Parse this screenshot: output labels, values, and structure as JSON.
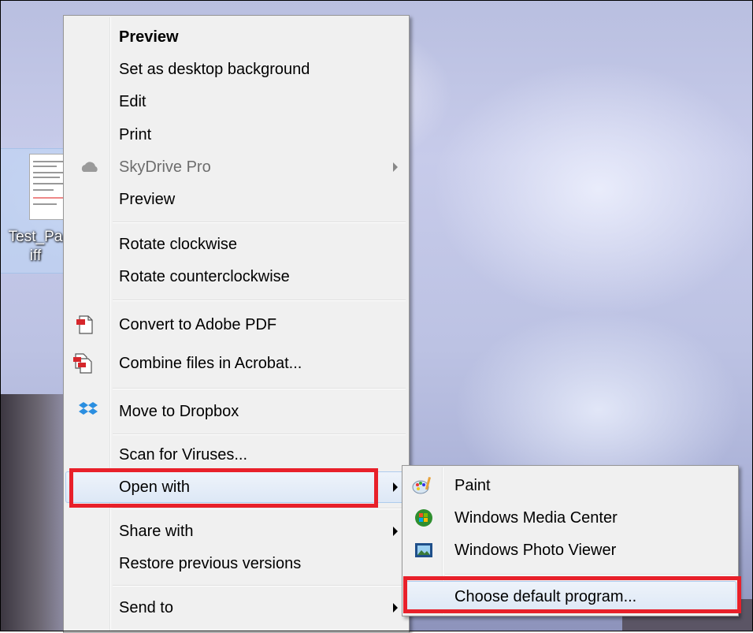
{
  "desktop": {
    "icon_label_line1": "Test_Pa",
    "icon_label_line2": "iff"
  },
  "context_menu": {
    "items": [
      {
        "label": "Preview",
        "bold": true
      },
      {
        "label": "Set as desktop background"
      },
      {
        "label": "Edit"
      },
      {
        "label": "Print"
      },
      {
        "label": "SkyDrive Pro",
        "disabled": true,
        "submenu": true,
        "icon": "skydrive-cloud-icon"
      },
      {
        "label": "Preview"
      },
      {
        "label": "Rotate clockwise"
      },
      {
        "label": "Rotate counterclockwise"
      },
      {
        "label": "Convert to Adobe PDF",
        "icon": "adobe-pdf-icon"
      },
      {
        "label": "Combine files in Acrobat...",
        "icon": "acrobat-combine-icon"
      },
      {
        "label": "Move to Dropbox",
        "icon": "dropbox-icon"
      },
      {
        "label": "Scan for Viruses..."
      },
      {
        "label": "Open with",
        "submenu": true,
        "highlighted": true
      },
      {
        "label": "Share with",
        "submenu": true
      },
      {
        "label": "Restore previous versions"
      },
      {
        "label": "Send to",
        "submenu": true
      }
    ]
  },
  "open_with_submenu": {
    "items": [
      {
        "label": "Paint",
        "icon": "paint-icon"
      },
      {
        "label": "Windows Media Center",
        "icon": "windows-media-center-icon"
      },
      {
        "label": "Windows Photo Viewer",
        "icon": "photo-viewer-icon"
      },
      {
        "label": "Choose default program...",
        "highlighted": true
      }
    ]
  },
  "colors": {
    "annotation_red": "#e8202a",
    "highlight_border": "#aecbed",
    "menu_bg": "#f0f0f0"
  }
}
